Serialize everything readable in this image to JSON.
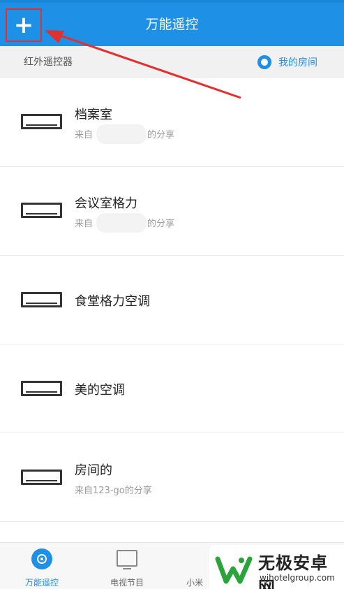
{
  "header": {
    "title": "万能遥控",
    "add_label": "+"
  },
  "subbar": {
    "left_label": "红外遥控器",
    "my_room_label": "我的房间"
  },
  "devices": [
    {
      "name": "档案室",
      "sub_prefix": "来自",
      "sub_suffix": "的分享"
    },
    {
      "name": "会议室格力",
      "sub_prefix": "来自",
      "sub_suffix": "的分享"
    },
    {
      "name": "食堂格力空调"
    },
    {
      "name": "美的空调"
    },
    {
      "name": "房间的",
      "sub": "来自123-go的分享"
    }
  ],
  "tabs": [
    {
      "label": "万能遥控",
      "active": true,
      "icon": "remote-icon"
    },
    {
      "label": "电视节目",
      "active": false,
      "icon": "tv-icon"
    },
    {
      "label": "小米",
      "active": false,
      "icon": "device-icon"
    }
  ],
  "watermark": {
    "title": "无极安卓网",
    "url": "wjhotelgroup.com"
  },
  "colors": {
    "brand_blue": "#1e90e6",
    "highlight_red": "#e0302f"
  }
}
